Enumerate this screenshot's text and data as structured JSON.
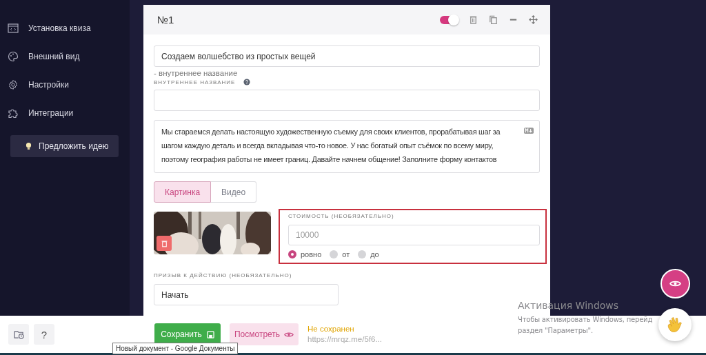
{
  "sidebar": {
    "items": [
      {
        "label": "Установка квиза",
        "kind": "code"
      },
      {
        "label": "Внешний вид",
        "kind": "palette"
      },
      {
        "label": "Настройки",
        "kind": "gear"
      },
      {
        "label": "Интеграции",
        "kind": "puzzle"
      }
    ],
    "idea_button": "Предложить идею"
  },
  "question": {
    "number": "№1",
    "enabled": true,
    "title_field": {
      "value": "Создаем волшебство из простых вещей"
    },
    "internal_name_hint": "- внутреннее название",
    "internal_name_label": "ВНУТРЕННЕЕ НАЗВАНИЕ",
    "description": "Мы стараемся делать настоящую художественную съемку для своих клиентов, прорабатывая шаг за шагом каждую деталь и всегда вкладывая что-то новое. У нас богатый опыт съёмок по всему миру, поэтому география работы не имеет границ. Давайте начнем общение! Заполните форму контактов",
    "media_tabs": [
      {
        "label": "Картинка",
        "selected": true
      },
      {
        "label": "Видео",
        "selected": false
      }
    ],
    "price": {
      "label": "СТОИМОСТЬ (НЕОБЯЗАТЕЛЬНО)",
      "placeholder": "10000",
      "options": [
        {
          "label": "ровно",
          "selected": true
        },
        {
          "label": "от",
          "selected": false
        },
        {
          "label": "до",
          "selected": false
        }
      ]
    },
    "cta": {
      "label": "ПРИЗЫВ К ДЕЙСТВИЮ (НЕОБЯЗАТЕЛЬНО)",
      "value": "Начать"
    }
  },
  "bottom_bar": {
    "help_button": "?",
    "save_button": "Сохранить",
    "preview_button": "Посмотреть",
    "status": "Не сохранен",
    "link": "https://mrqz.me/5f6..."
  },
  "tooltip": "Новый документ - Google Документы",
  "windows_notice": {
    "title": "Активация Windows",
    "lines": [
      "Чтобы активировать Windows, перейд",
      "раздел \"Параметры\"."
    ]
  }
}
